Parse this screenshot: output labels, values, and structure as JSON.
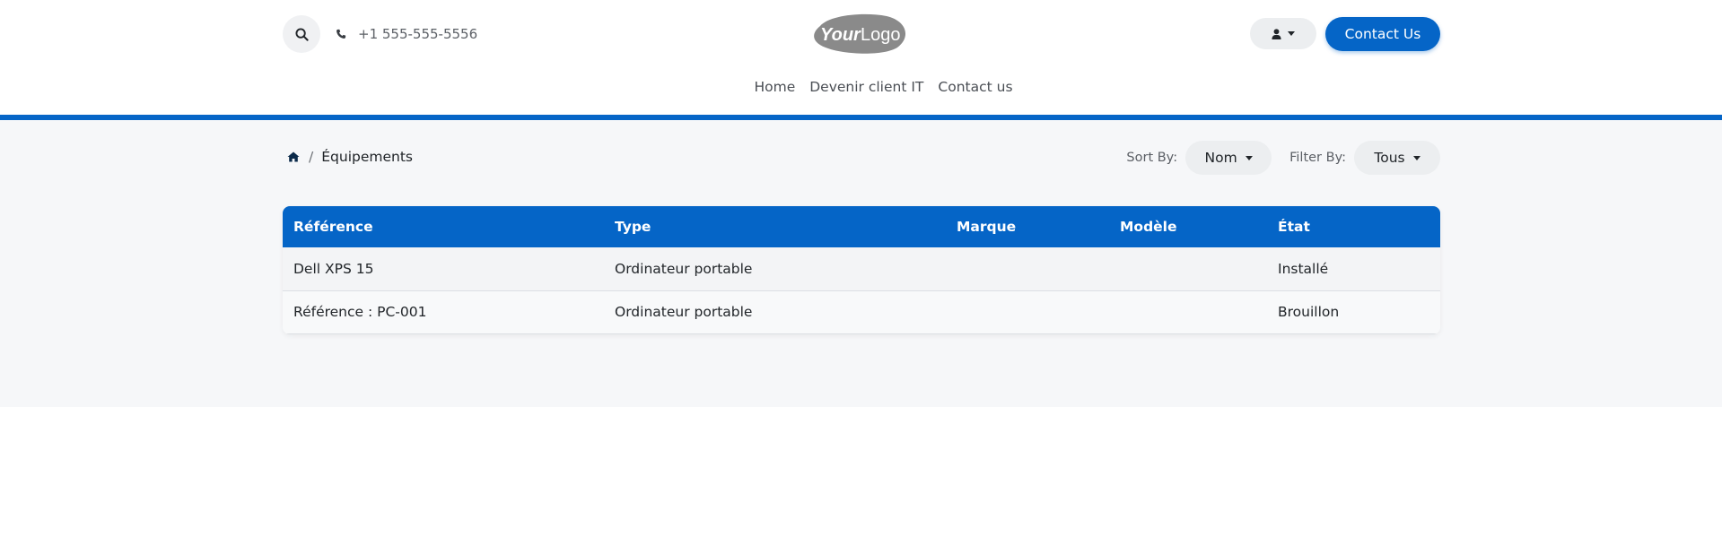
{
  "header": {
    "phone": "+1 555-555-5556",
    "logo_text": "YourLogo",
    "contact_button": "Contact Us",
    "icons": {
      "search": "search-icon",
      "phone": "phone-icon",
      "user": "user-icon",
      "caret": "caret-down-icon",
      "home": "home-icon"
    }
  },
  "nav": {
    "items": [
      {
        "label": "Home"
      },
      {
        "label": "Devenir client IT"
      },
      {
        "label": "Contact us"
      }
    ]
  },
  "breadcrumb": {
    "separator": "/",
    "current": "Équipements"
  },
  "controls": {
    "sort_label": "Sort By:",
    "sort_value": "Nom",
    "filter_label": "Filter By:",
    "filter_value": "Tous"
  },
  "table": {
    "headers": [
      "Référence",
      "Type",
      "Marque",
      "Modèle",
      "État"
    ],
    "rows": [
      {
        "reference": "Dell XPS 15",
        "type": "Ordinateur portable",
        "marque": "",
        "modele": "",
        "etat": "Installé"
      },
      {
        "reference": "Référence : PC-001",
        "type": "Ordinateur portable",
        "marque": "",
        "modele": "",
        "etat": "Brouillon"
      }
    ]
  },
  "colors": {
    "primary": "#0565c7",
    "background_section": "#f6f7f9"
  }
}
